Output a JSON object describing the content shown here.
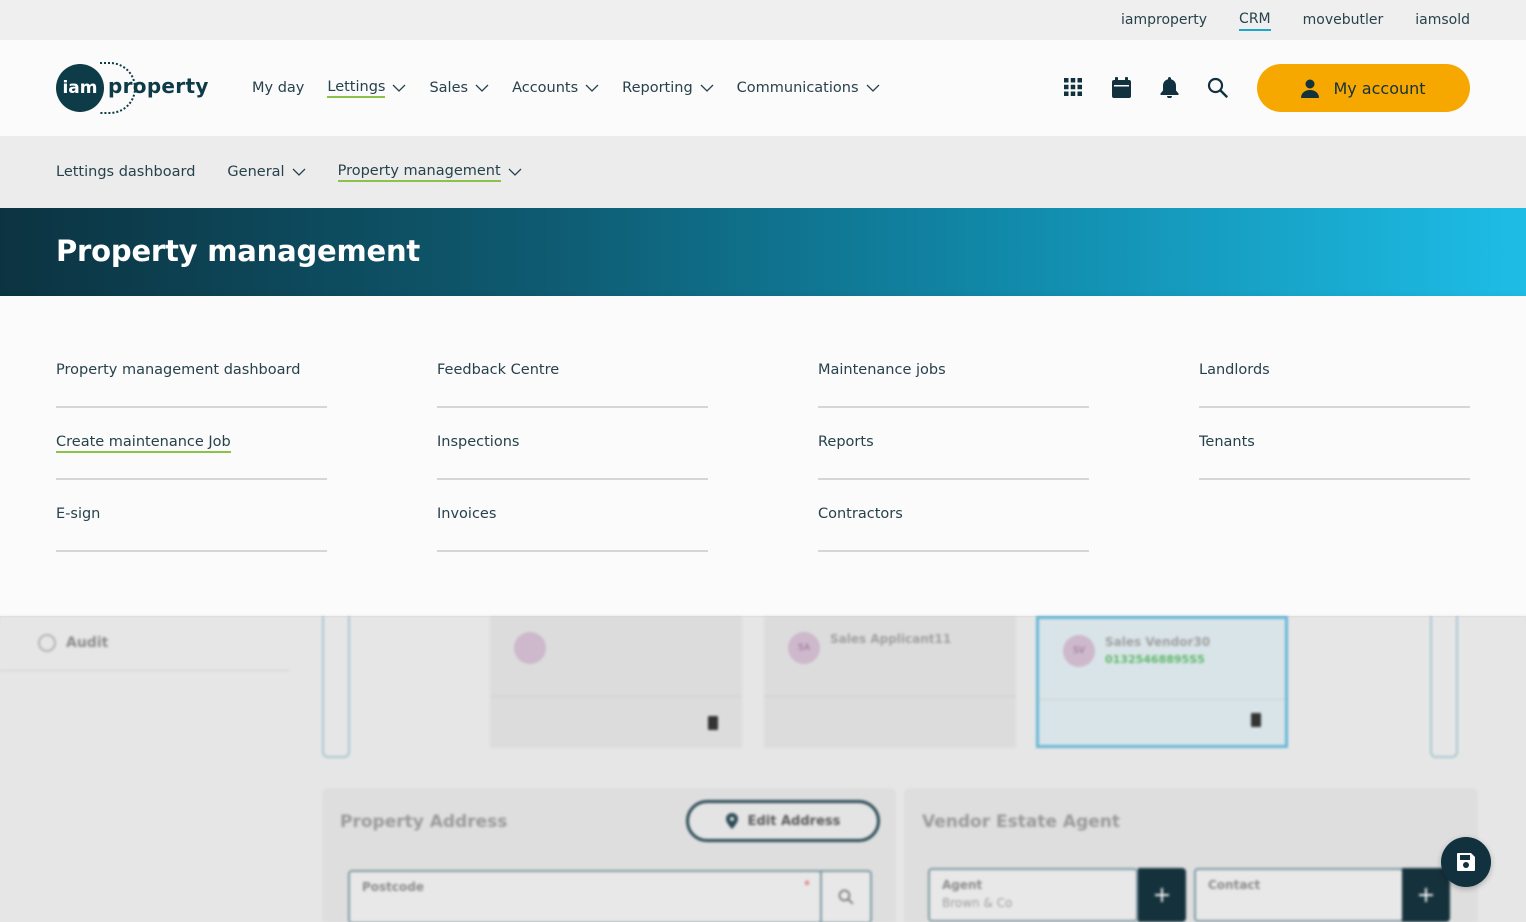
{
  "topbar": {
    "links": [
      {
        "label": "iamproperty",
        "active": false
      },
      {
        "label": "CRM",
        "active": true
      },
      {
        "label": "movebutler",
        "active": false
      },
      {
        "label": "iamsold",
        "active": false
      }
    ]
  },
  "header": {
    "logo": {
      "mark": "iam",
      "word": "property"
    },
    "nav": [
      {
        "label": "My day",
        "dropdown": false,
        "active": false
      },
      {
        "label": "Lettings",
        "dropdown": true,
        "active": true
      },
      {
        "label": "Sales",
        "dropdown": true,
        "active": false
      },
      {
        "label": "Accounts",
        "dropdown": true,
        "active": false
      },
      {
        "label": "Reporting",
        "dropdown": true,
        "active": false
      },
      {
        "label": "Communications",
        "dropdown": true,
        "active": false
      }
    ],
    "icons": [
      "apps-grid-icon",
      "calendar-icon",
      "bell-icon",
      "search-icon"
    ],
    "account_label": "My account"
  },
  "subnav": {
    "dashboard": "Lettings dashboard",
    "general": "General",
    "property_management": "Property management"
  },
  "banner": {
    "title": "Property management"
  },
  "menu": {
    "columns": [
      [
        "Property management dashboard",
        "Create maintenance Job",
        "E-sign"
      ],
      [
        "Feedback Centre",
        "Inspections",
        "Invoices"
      ],
      [
        "Maintenance jobs",
        "Reports",
        "Contractors"
      ],
      [
        "Landlords",
        "Tenants"
      ]
    ]
  },
  "background": {
    "audit": "Audit",
    "cards": [
      {
        "initials": "",
        "name": "",
        "phone": ""
      },
      {
        "initials": "SA",
        "name": "Sales Applicant11",
        "phone": ""
      },
      {
        "initials": "SV",
        "name": "Sales Vendor30",
        "phone": "01325468895S5"
      }
    ],
    "property_address": {
      "title": "Property Address",
      "edit_button": "Edit Address",
      "postcode_label": "Postcode",
      "required_mark": "*"
    },
    "vendor_agent": {
      "title": "Vendor Estate Agent",
      "agent_label": "Agent",
      "agent_value": "Brown & Co",
      "contact_label": "Contact",
      "plus": "+"
    }
  },
  "colors": {
    "accent": "#f7a800",
    "active_underline": "#8bc34a",
    "crm_underline": "#1ea6c8",
    "brand_dark": "#0d3b48"
  }
}
